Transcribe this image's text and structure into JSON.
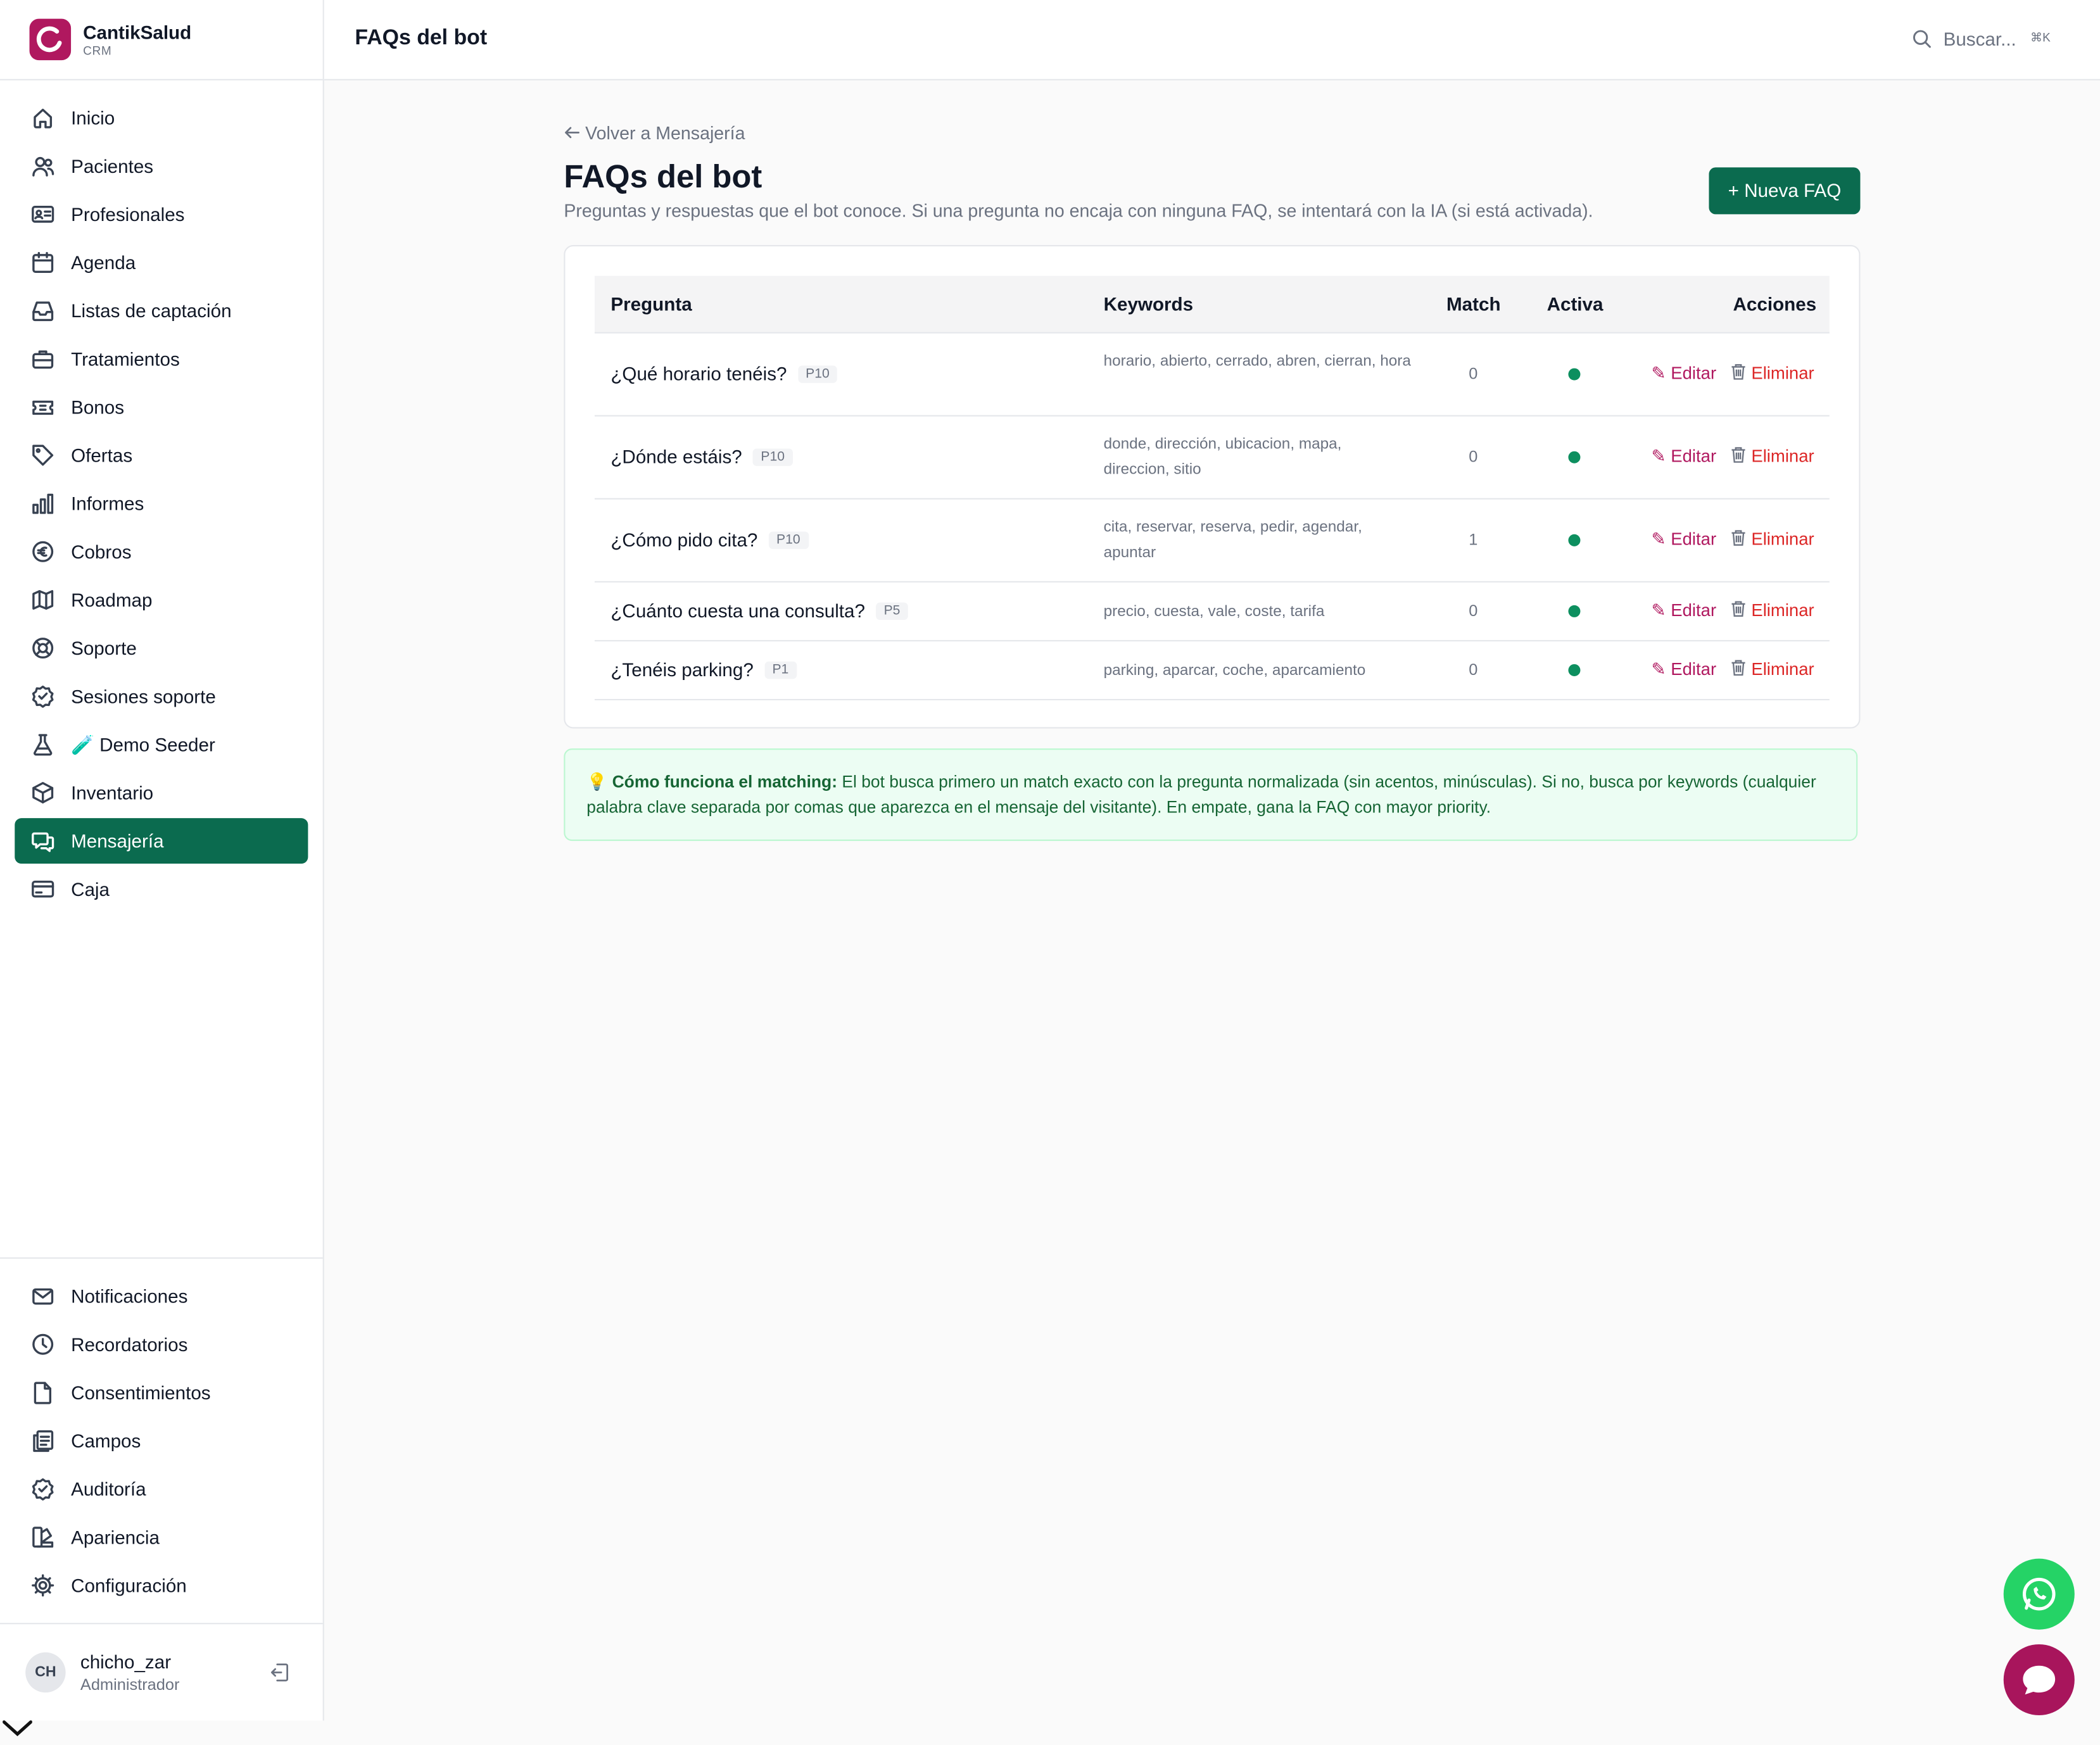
{
  "brand": {
    "name": "CantikSalud",
    "sub": "CRM"
  },
  "nav_main": [
    {
      "label": "Inicio",
      "icon": "home-icon"
    },
    {
      "label": "Pacientes",
      "icon": "users-icon"
    },
    {
      "label": "Profesionales",
      "icon": "id-card-icon"
    },
    {
      "label": "Agenda",
      "icon": "calendar-icon"
    },
    {
      "label": "Listas de captación",
      "icon": "inbox-icon"
    },
    {
      "label": "Tratamientos",
      "icon": "briefcase-icon"
    },
    {
      "label": "Bonos",
      "icon": "ticket-icon"
    },
    {
      "label": "Ofertas",
      "icon": "tag-icon"
    },
    {
      "label": "Informes",
      "icon": "bar-chart-icon"
    },
    {
      "label": "Cobros",
      "icon": "euro-icon"
    },
    {
      "label": "Roadmap",
      "icon": "map-icon"
    },
    {
      "label": "Soporte",
      "icon": "lifebuoy-icon"
    },
    {
      "label": "Sesiones soporte",
      "icon": "check-badge-icon"
    },
    {
      "label": "🧪 Demo Seeder",
      "icon": "flask-icon"
    },
    {
      "label": "Inventario",
      "icon": "box-icon"
    },
    {
      "label": "Mensajería",
      "icon": "chat-icon",
      "active": true
    },
    {
      "label": "Caja",
      "icon": "credit-card-icon"
    }
  ],
  "nav_bottom": [
    {
      "label": "Notificaciones",
      "icon": "mail-icon"
    },
    {
      "label": "Recordatorios",
      "icon": "clock-icon"
    },
    {
      "label": "Consentimientos",
      "icon": "file-icon"
    },
    {
      "label": "Campos",
      "icon": "clipboard-icon"
    },
    {
      "label": "Auditoría",
      "icon": "shield-check-icon"
    },
    {
      "label": "Apariencia",
      "icon": "palette-icon"
    },
    {
      "label": "Configuración",
      "icon": "gear-icon"
    }
  ],
  "user": {
    "initials": "CH",
    "name": "chicho_zar",
    "role": "Administrador"
  },
  "topbar": {
    "title": "FAQs del bot",
    "search_placeholder": "Buscar...",
    "shortcut": "⌘K"
  },
  "page": {
    "back_label": "Volver a Mensajería",
    "title": "FAQs del bot",
    "subtitle": "Preguntas y respuestas que el bot conoce. Si una pregunta no encaja con ninguna FAQ, se intentará con la IA (si está activada).",
    "new_button": "+ Nueva FAQ"
  },
  "table": {
    "headers": {
      "question": "Pregunta",
      "keywords": "Keywords",
      "match": "Match",
      "active": "Activa",
      "actions": "Acciones"
    },
    "rows": [
      {
        "question": "¿Qué horario tenéis?",
        "priority": "P10",
        "keywords": "horario, abierto, cerrado, abren, cierran, hora",
        "match": "0",
        "active": true,
        "edit": "Editar",
        "delete": "Eliminar"
      },
      {
        "question": "¿Dónde estáis?",
        "priority": "P10",
        "keywords": "donde, dirección, ubicacion, mapa, direccion, sitio",
        "match": "0",
        "active": true,
        "edit": "Editar",
        "delete": "Eliminar"
      },
      {
        "question": "¿Cómo pido cita?",
        "priority": "P10",
        "keywords": "cita, reservar, reserva, pedir, agendar, apuntar",
        "match": "1",
        "active": true,
        "edit": "Editar",
        "delete": "Eliminar"
      },
      {
        "question": "¿Cuánto cuesta una consulta?",
        "priority": "P5",
        "keywords": "precio, cuesta, vale, coste, tarifa",
        "match": "0",
        "active": true,
        "edit": "Editar",
        "delete": "Eliminar"
      },
      {
        "question": "¿Tenéis parking?",
        "priority": "P1",
        "keywords": "parking, aparcar, coche, aparcamiento",
        "match": "0",
        "active": true,
        "edit": "Editar",
        "delete": "Eliminar"
      }
    ]
  },
  "info": {
    "icon": "lightbulb-icon",
    "title": "Cómo funciona el matching:",
    "text": " El bot busca primero un match exacto con la pregunta normalizada (sin acentos, minúsculas). Si no, busca por keywords (cualquier palabra clave separada por comas que aparezca en el mensaje del visitante). En empate, gana la FAQ con mayor priority."
  },
  "colors": {
    "accent": "#0b6b4f",
    "brand": "#b0185f",
    "danger": "#dc2626",
    "active_dot": "#0d8f5f",
    "whatsapp": "#25d366"
  }
}
